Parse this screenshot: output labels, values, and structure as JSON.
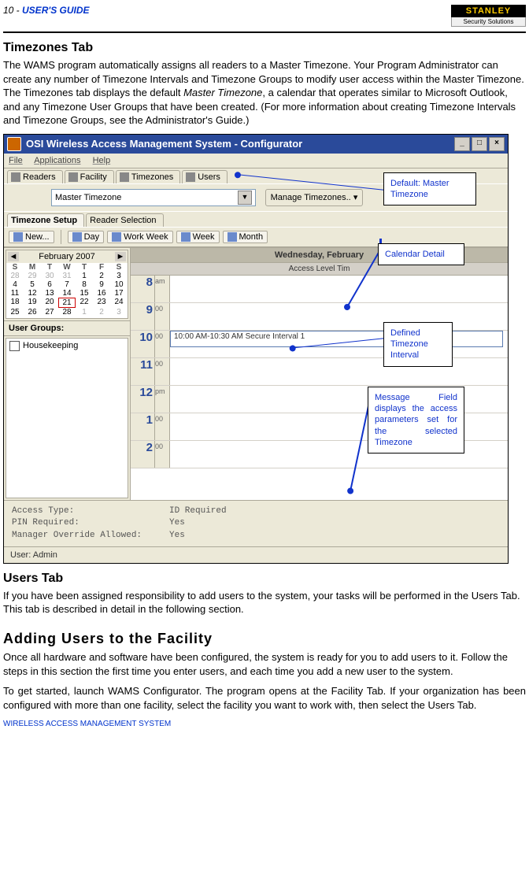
{
  "header": {
    "page_label_prefix": "10 - ",
    "page_label": "USER'S GUIDE",
    "logo_top": "STANLEY",
    "logo_bottom": "Security Solutions"
  },
  "sections": {
    "tz_title": "Timezones Tab",
    "tz_body": "The WAMS program automatically assigns all readers to a Master Timezone.   Your Program Administrator can create any number of Timezone Intervals and Timezone Groups to modify user access within the Master Timezone.   The Timezones tab displays the default ",
    "tz_body_ital": "Master Timezone",
    "tz_body_after": ", a calendar that operates similar to Microsoft Outlook, and any Timezone User Groups that have been created.   (For more information about creating Timezone Intervals and Timezone Groups, see the Administrator's Guide.)",
    "users_title": "Users Tab",
    "users_body": "If you have been assigned responsibility to add users to the system, your tasks will be performed in the Users Tab.   This tab is described in detail in the following section.",
    "add_title": "Adding Users to the Facility",
    "add_body1": "Once all hardware and software have been configured, the system is ready for you to add users to it.   Follow the steps in this section the first time you enter users, and each time you add a new user to the system.",
    "add_body2": "To get started, launch WAMS Configurator.   The program opens at the Facility Tab.   If your organization has been configured with more than one facility, select the facility you want to work with, then select the Users Tab."
  },
  "screenshot": {
    "title": "OSI Wireless Access Management System - Configurator",
    "menu": {
      "file": "File",
      "applications": "Applications",
      "help": "Help"
    },
    "main_tabs": [
      "Readers",
      "Facility",
      "Timezones",
      "Users"
    ],
    "dropdown_value": "Master Timezone",
    "manage_btn": "Manage Timezones..",
    "sub_tabs": {
      "setup": "Timezone Setup",
      "reader": "Reader Selection"
    },
    "toolbar": {
      "new": "New...",
      "day": "Day",
      "work_week": "Work Week",
      "week": "Week",
      "month": "Month"
    },
    "calendar": {
      "month_label": "February 2007",
      "day_headers": [
        "S",
        "M",
        "T",
        "W",
        "T",
        "F",
        "S"
      ],
      "weeks": [
        [
          "28",
          "29",
          "30",
          "31",
          "1",
          "2",
          "3"
        ],
        [
          "4",
          "5",
          "6",
          "7",
          "8",
          "9",
          "10"
        ],
        [
          "11",
          "12",
          "13",
          "14",
          "15",
          "16",
          "17"
        ],
        [
          "18",
          "19",
          "20",
          "21",
          "22",
          "23",
          "24"
        ],
        [
          "25",
          "26",
          "27",
          "28",
          "1",
          "2",
          "3"
        ]
      ],
      "today": "21",
      "user_groups_label": "User Groups:",
      "user_group_item": "Housekeeping",
      "day_header": "Wednesday, February",
      "day_subheader": "Access Level Tim",
      "hours": [
        "8",
        "9",
        "10",
        "11",
        "12",
        "1",
        "2"
      ],
      "am": "am",
      "pm": "pm",
      "zero": "00",
      "appointment": "10:00 AM-10:30 AM Secure Interval 1"
    },
    "message": {
      "access_type_k": "Access Type:",
      "access_type_v": "ID Required",
      "pin_k": "PIN Required:",
      "pin_v": "Yes",
      "mgr_k": "Manager Override Allowed:",
      "mgr_v": "Yes"
    },
    "status": "User: Admin"
  },
  "callouts": {
    "c1": "Default: Master Timezone",
    "c2": "Calendar Detail",
    "c3": "Defined Timezone Interval",
    "c4": "Message Field displays the access parameters set for the selected Timezone"
  },
  "footer": "WIRELESS ACCESS MANAGEMENT SYSTEM"
}
